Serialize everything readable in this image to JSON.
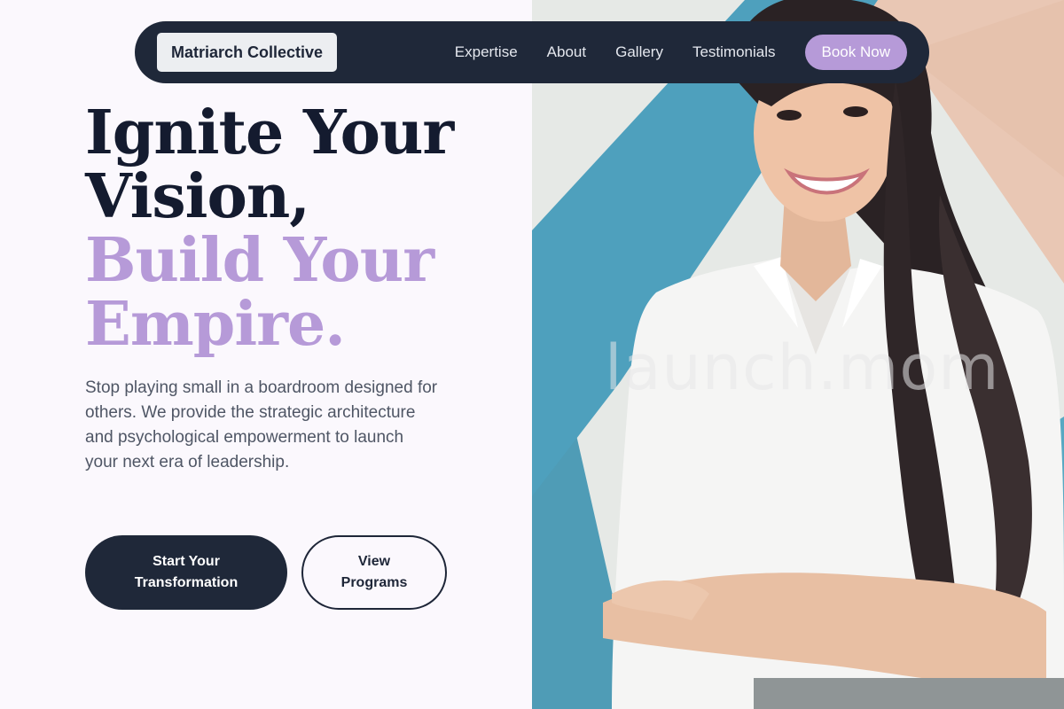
{
  "nav": {
    "brand": "Matriarch Collective",
    "links": [
      "Expertise",
      "About",
      "Gallery",
      "Testimonials"
    ],
    "cta": "Book Now"
  },
  "hero": {
    "headline_line1": "Ignite Your",
    "headline_line2": "Vision,",
    "headline_accent_line1": "Build Your",
    "headline_accent_line2": "Empire.",
    "lead": "Stop playing small in a boardroom designed for others. We provide the strategic architecture and psychological empowerment to launch your next era of leadership.",
    "primary_cta_line1": "Start Your",
    "primary_cta_line2": "Transformation",
    "secondary_cta_line1": "View",
    "secondary_cta_line2": "Programs"
  },
  "photo": {
    "watermark": "launch.mom"
  },
  "colors": {
    "navy": "#1f2839",
    "accent_lavender": "#b69ad8",
    "page_background": "#fbf8fd",
    "body_text": "#4f5665"
  }
}
